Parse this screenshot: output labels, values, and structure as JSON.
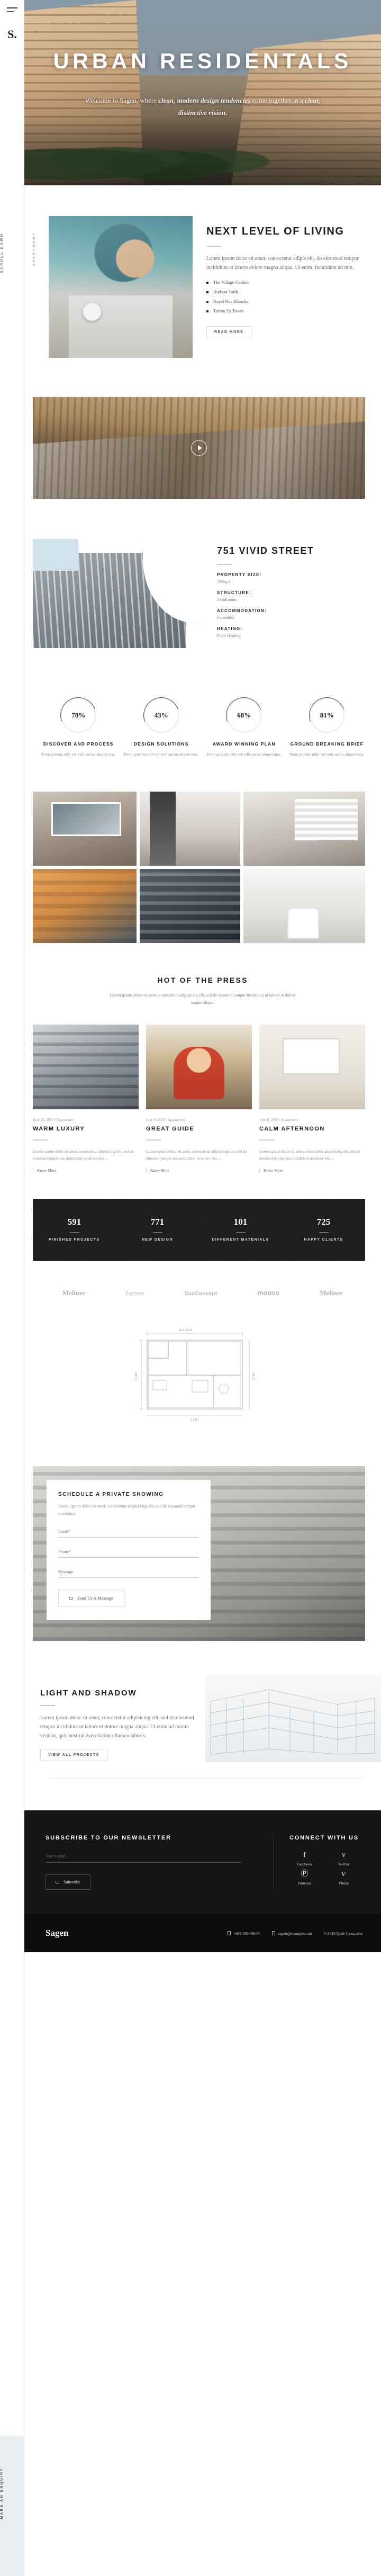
{
  "rail": {
    "logo": "S.",
    "menu_icon": "hamburger-menu-icon",
    "vertical_label_top": "SCROLL DOWN",
    "vertical_label_bottom": "MAKE AN ENQUIRY"
  },
  "hero": {
    "title": "URBAN RESIDENTALS",
    "subtitle_plain_1": "Welcome to Sagen, where ",
    "subtitle_em_1": "clean, modern design tendencies",
    "subtitle_plain_2": " come together in a ",
    "subtitle_em_2": "clear, distinctive vision."
  },
  "next_level": {
    "side_label": "APARTMENT",
    "title": "NEXT LEVEL OF LIVING",
    "body": "Lorem ipsum dolor sit amet, consectetur adipis elit, do eius mod tempor incididunt ut labore dolore magna aliqua. Ut enim. Incididunt ad min.",
    "list": [
      "The Village Garden",
      "Hudson Yards",
      "Royal Rue Blanche",
      "Torino Ey Tower"
    ],
    "button": "READ MORE"
  },
  "panorama": {
    "play_icon": "play-icon"
  },
  "vivid": {
    "title": "751 VIVID STREET",
    "specs": [
      {
        "key": "PROPERTY SIZE:",
        "value": "700sq ft"
      },
      {
        "key": "STRUCTURE:",
        "value": "2 badrooms"
      },
      {
        "key": "ACCOMMODATION:",
        "value": "Furnished"
      },
      {
        "key": "HEATING:",
        "value": "Floor Heating"
      }
    ]
  },
  "circles": [
    {
      "value": "78%",
      "title": "DISCOVER AND PROCESS",
      "body": "Proin gravida nibh vel velit auctor aliquet mas."
    },
    {
      "value": "43%",
      "title": "DESIGN SOLUTIONS",
      "body": "Proin gravida nibh vel velit auctor aliquet mas."
    },
    {
      "value": "68%",
      "title": "AWARD WINNING PLAN",
      "body": "Proin gravida nibh vel velit auctor aliquet mas."
    },
    {
      "value": "81%",
      "title": "GROUND BREAKING BRIEF",
      "body": "Proin gravida nibh vel velit auctor aliquet mas."
    }
  ],
  "press": {
    "heading": "HOT OF THE PRESS",
    "subheading": "Lorem ipsum dolor sit amet, consectetur adipisicing elit, sed do eiusmod tempor incididunt ut labore et dolore magna aliqua.",
    "cards": [
      {
        "meta": "June 10, 2019 / Apartments",
        "title": "WARM LUXURY",
        "body": "Lorem ipsum dolor sit amet, consectetur adipisicing elit, sed do eiusmod tempor nus indididunt ut labore etis ...",
        "link": "Know More"
      },
      {
        "meta": "June 9, 2019 / Apartments",
        "title": "GREAT GUIDE",
        "body": "Lorem ipsum dolor sit amet, consectetur adipisicing elit, sed do eiusmod tempor nus indididunt ut labore etis ...",
        "link": "Know More"
      },
      {
        "meta": "June 8, 2019 / Apartments",
        "title": "CALM AFTERNOON",
        "body": "Lorem ipsum dolor sit amet, consectetur adipisicing elit, sed do eiusmod tempor nus indididunt ut labore etis ...",
        "link": "Know More"
      }
    ]
  },
  "counters": [
    {
      "number": "591",
      "label": "FINISHED PROJECTS"
    },
    {
      "number": "771",
      "label": "NEW DESIGN"
    },
    {
      "number": "101",
      "label": "DIFFERENT MATERIALS"
    },
    {
      "number": "725",
      "label": "HAPPY CLIENTS"
    }
  ],
  "clients": [
    {
      "name": "Meliner",
      "style": "serif"
    },
    {
      "name": "Lavere",
      "style": "script"
    },
    {
      "name": "SunConcept",
      "style": "sans"
    },
    {
      "name": "moovo",
      "style": "round"
    },
    {
      "name": "Meliner",
      "style": "serif"
    }
  ],
  "floorplan": {
    "dim_top": "46.5 SQ.M.",
    "dim_left": "4.2 MT",
    "dim_bottom": "6.1 MT",
    "dim_right": "3.8 MT"
  },
  "schedule": {
    "title": "SCHEDULE A PRIVATE SHOWING",
    "body": "Lorem ipsum dolor sit amet, consectetur adipisi cing elit, sed do eiusmod tempor incididunt.",
    "fields": [
      {
        "label": "Email*",
        "value": ""
      },
      {
        "label": "Phone*",
        "value": ""
      },
      {
        "label": "Message",
        "value": ""
      }
    ],
    "button": "Send Us A Message",
    "button_icon": "envelope-icon"
  },
  "light_shadow": {
    "title": "LIGHT AND SHADOW",
    "body": "Lorem ipsum dolor sit amet, consectetur adipisicing elit, sed do eiusmod tempor incididunt ut labore et dolore magna aliqua. Ut enim ad minim veniam, quis nostrud exercitation ullamco laboris.",
    "button": "VIEW ALL PROJECTS"
  },
  "footer": {
    "newsletter_heading": "SUBSCRIBE TO OUR NEWSLETTER",
    "email_placeholder": "Your e-mail...",
    "subscribe_button": "Subscribe",
    "subscribe_icon": "envelope-icon",
    "connect_heading": "CONNECT WITH US",
    "socials": [
      {
        "icon": "facebook-icon",
        "glyph": "f",
        "label": "Facebook"
      },
      {
        "icon": "twitter-icon",
        "glyph": "ᴠ",
        "label": "Twitter"
      },
      {
        "icon": "pinterest-icon",
        "glyph": "Ⓟ",
        "label": "Pinterest"
      },
      {
        "icon": "vimeo-icon",
        "glyph": "ѵ",
        "label": "Vimeo"
      }
    ],
    "logo": "Sagen",
    "phone": "+585 889 996 96",
    "email": "sagen@example.com",
    "copyright": "© 2019 Qode Interactive"
  },
  "colors": {
    "dark": "#1c1c1c",
    "darker": "#0c0c0c",
    "accent_blue": "#cfe3ef",
    "muted": "#8d8d8d"
  }
}
